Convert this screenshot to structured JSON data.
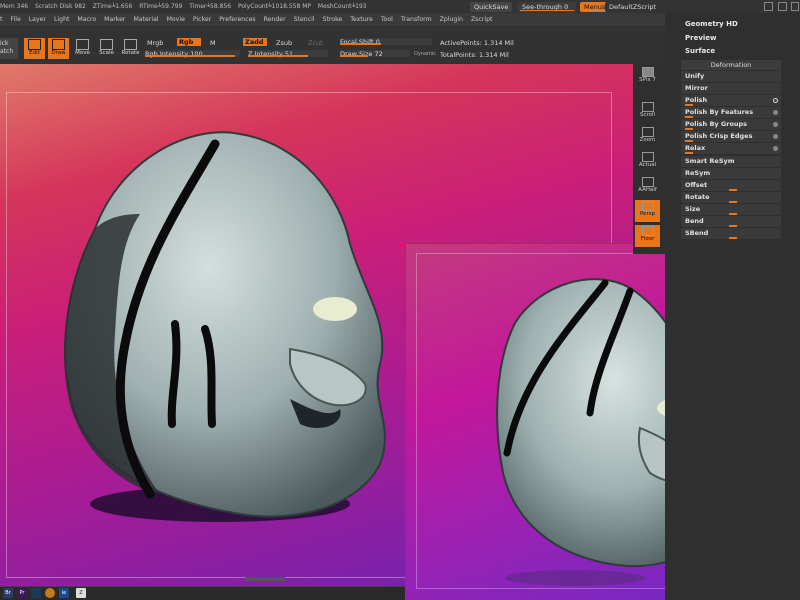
{
  "status": {
    "mem": "Mem 346",
    "scratch": "Scratch Disk 982",
    "ztime": "ZTime┶1.656",
    "rtime": "RTime┶59.799",
    "timer": "Timer┶58.856",
    "polycount": "PolyCount┶1018.558 MP",
    "meshcount": "MeshCount┶193",
    "quicksave": "QuickSave",
    "seethrough": "See-through  0",
    "menus": "Menus",
    "script": "DefaultZScript"
  },
  "menubar": [
    "t",
    "File",
    "Layer",
    "Light",
    "Macro",
    "Marker",
    "Material",
    "Movie",
    "Picker",
    "Preferences",
    "Render",
    "Stencil",
    "Stroke",
    "Texture",
    "Tool",
    "Transform",
    "Zplugin",
    "Zscript"
  ],
  "toolbar": {
    "quicksketch": "ick\natch",
    "edit": "Edit",
    "draw": "Draw",
    "move": "Move",
    "scale": "Scale",
    "rotate": "Rotate",
    "mrgb": "Mrgb",
    "rgb": "Rgb",
    "m": "M",
    "rgb_intensity": "Rgb Intensity 100",
    "zadd": "Zadd",
    "zsub": "Zsub",
    "zcut": "Zcut",
    "z_intensity": "Z Intensity 51",
    "focal_shift": "Focal Shift 0",
    "draw_size": "Draw Size 72",
    "dynamic": "Dynamic",
    "active_points": "ActivePoints: 1.314 Mil",
    "total_points": "TotalPoints: 1.314 Mil"
  },
  "iconcol": {
    "spix": "SPix 7",
    "scroll": "Scroll",
    "zoom": "Zoom",
    "actual": "Actual",
    "aahalf": "AAHalf",
    "persp": "Persp",
    "floor": "Floor"
  },
  "rpanel": {
    "geometry_hd": "Geometry HD",
    "preview": "Preview",
    "surface": "Surface",
    "deformation": "Deformation",
    "rows": [
      "Unify",
      "Mirror",
      "Polish",
      "Polish By Features",
      "Polish By Groups",
      "Polish Crisp Edges",
      "Relax",
      "Smart ReSym",
      "ReSym",
      "Offset",
      "Rotate",
      "Size",
      "Bend",
      "SBend"
    ]
  },
  "colors": {
    "accent": "#e8761c",
    "panel": "#2f2f2f",
    "canvas_top": "#d5355a",
    "canvas_bottom": "#6a23b3"
  },
  "taskbar": [
    "Br",
    "Pr",
    "app",
    "ie",
    "app",
    "Z"
  ]
}
